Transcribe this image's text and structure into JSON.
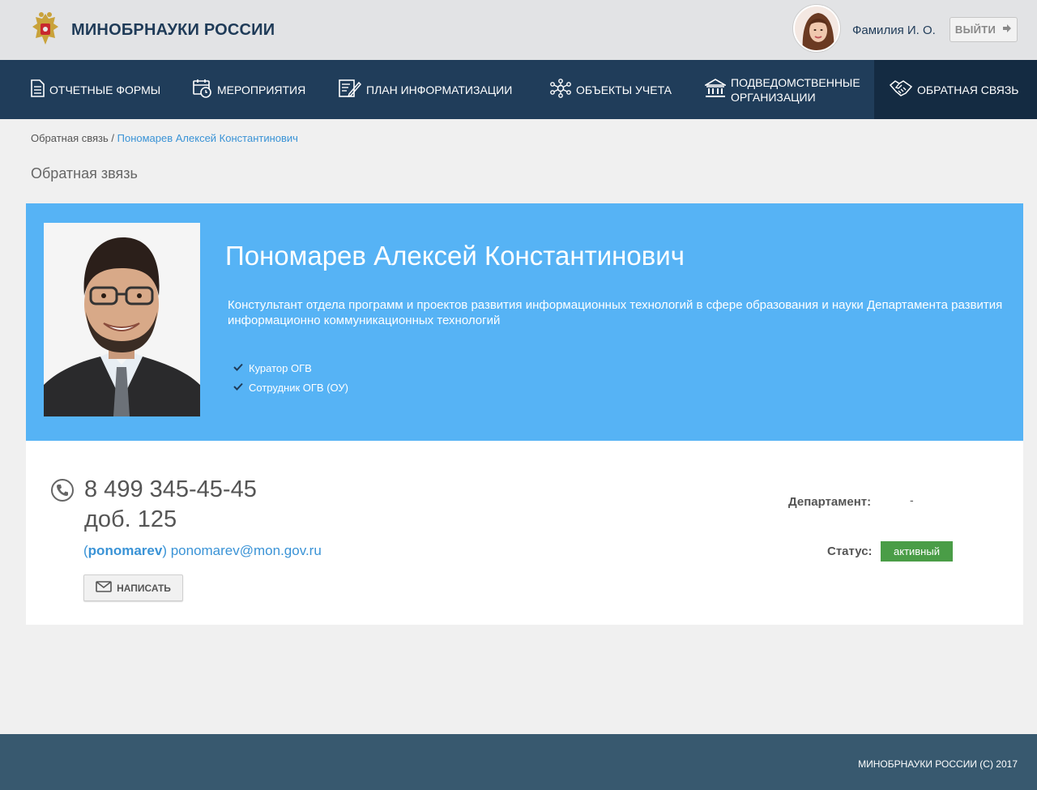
{
  "header": {
    "brand": "МИНОБРНАУКИ РОССИИ",
    "user_name": "Фамилия И. О.",
    "logout_label": "ВЫЙТИ"
  },
  "nav": {
    "items": [
      {
        "label": "ОТЧЕТНЫЕ ФОРМЫ",
        "icon": "document-list-icon"
      },
      {
        "label": "МЕРОПРИЯТИЯ",
        "icon": "calendar-clock-icon"
      },
      {
        "label": "ПЛАН ИНФОРМАТИЗАЦИИ",
        "icon": "edit-document-icon"
      },
      {
        "label": "ОБЪЕКТЫ УЧЕТА",
        "icon": "network-nodes-icon"
      },
      {
        "label_line1": "ПОДВЕДОМСТВЕННЫЕ",
        "label_line2": "ОРГАНИЗАЦИИ",
        "icon": "institution-icon"
      },
      {
        "label": "ОБРАТНАЯ СВЯЗЬ",
        "icon": "handshake-icon",
        "active": true
      }
    ]
  },
  "breadcrumb": {
    "root": "Обратная связь",
    "separator": " / ",
    "current": "Пономарев Алексей Константинович"
  },
  "page": {
    "title": "Обратная звязь"
  },
  "profile": {
    "name": "Пономарев Алексей Константинович",
    "description": "Констультант отдела программ и проектов развития информационных технологий в сфере образования и науки Департамента развития информационно  коммуникационных технологий",
    "roles": [
      "Куратор ОГВ",
      "Сотрудник ОГВ (ОУ)"
    ]
  },
  "contact": {
    "phone": "8 499 345-45-45",
    "extension": "доб. 125",
    "login": "ponomarev",
    "email": "ponomarev@mon.gov.ru",
    "write_label": "НАПИСАТЬ",
    "department_label": "Департамент:",
    "department_value": "-",
    "status_label": "Статус:",
    "status_value": "активный"
  },
  "footer": {
    "text": "МИНОБРНАУКИ РОССИИ  (С) 2017"
  },
  "colors": {
    "header_bg": "#e2e3e5",
    "nav_bg": "#203d5a",
    "nav_active_bg": "#142b42",
    "profile_bg": "#56b3f5",
    "status_green": "#4a9d47",
    "footer_bg": "#38596f",
    "link_blue": "#3a93d6"
  }
}
